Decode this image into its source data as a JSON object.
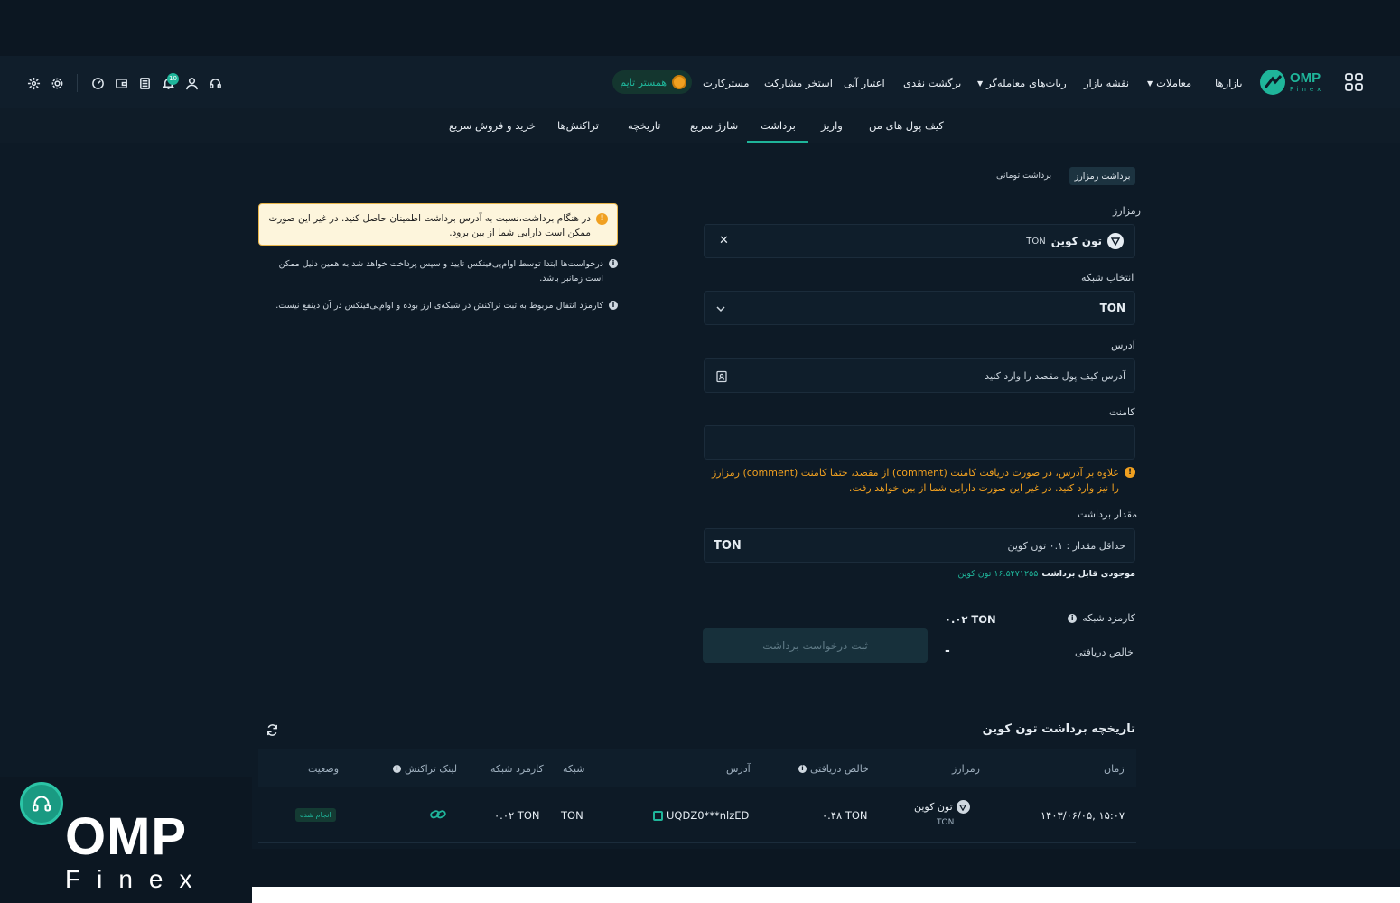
{
  "brand": {
    "name": "OMP",
    "sub": "Finex"
  },
  "nav": {
    "markets": "بازارها",
    "trades": "معاملات",
    "market_map": "نقشه بازار",
    "bots": "ربات‌های معامله‌گر",
    "cashback": "برگشت نقدی",
    "instant_credit": "اعتبار آنی",
    "pool": "استخر مشارکت",
    "subscriptions": "مستر‌کارت",
    "hamster": "همستر تایم",
    "notif_count": "10"
  },
  "subnav": {
    "wallet": "کیف پول های من",
    "deposit": "واریز",
    "withdraw": "برداشت",
    "quick_charge": "شارژ سریع",
    "history": "تاریخچه",
    "transactions": "تراکنش‌ها",
    "quick_trade": "خرید و فروش سریع"
  },
  "form": {
    "tab_crypto": "برداشت رمزارز",
    "tab_toman": "برداشت تومانی",
    "crypto_label": "رمزارز",
    "coin_name": "تون کوین",
    "coin_symbol": "TON",
    "network_label": "انتخاب شبکه",
    "network_value": "TON",
    "address_label": "آدرس",
    "address_placeholder": "آدرس کیف پول مقصد را وارد کنید",
    "comment_label": "کامنت",
    "comment_warning": "علاوه بر آدرس، در صورت دریافت کامنت (comment) از مقصد، حتما کامنت (comment) رمزارز را نیز وارد کنید. در غیر این صورت دارایی شما از بین خواهد رفت.",
    "amount_label": "مقدار برداشت",
    "amount_placeholder": "حداقل مقدار : ۰.۱ تون کوین",
    "amount_unit": "TON",
    "balance_label": "موجودی قابل برداشت",
    "balance_value": "۱۶.۵۴۷۱۲۵۵ تون کوین",
    "fee_label": "کارمزد شبکه",
    "fee_value": "۰.۰۲ TON",
    "net_label": "خالص دریافتی",
    "net_value": "-",
    "submit": "ثبت درخواست برداشت"
  },
  "notices": {
    "warning": "در هنگام برداشت،نسبت به آدرس برداشت اطمینان حاصل کنید. در غیر این صورت ممکن است دارایی شما از بین برود.",
    "info1": "درخواست‌ها ابتدا توسط اوام‌پی‌فینکس تایید و سپس پرداخت خواهد شد به همین دلیل ممکن است زمانبر باشد.",
    "info2": "کارمزد انتقال مربوط به ثبت تراکنش در شبکه‌ی ارز بوده و اوام‌پی‌فینکس در آن ذینفع نیست."
  },
  "history": {
    "title": "تاریخچه برداشت تون کوین",
    "columns": {
      "time": "زمان",
      "crypto": "رمزارز",
      "net": "خالص دریافتی",
      "address": "آدرس",
      "network": "شبکه",
      "fee": "کارمزد شبکه",
      "tx_link": "لینک تراکنش",
      "status": "وضعیت"
    },
    "rows": [
      {
        "time": "۱۴۰۳/۰۶/۰۵, ۱۵:۰۷",
        "coin": "تون کوین",
        "symbol": "TON",
        "net": "۰.۴۸ TON",
        "address": "UQDZ0***nlzED",
        "network": "TON",
        "fee": "۰.۰۲ TON",
        "status": "انجام شده"
      }
    ]
  },
  "colors": {
    "accent": "#1fb59a",
    "warning": "#f0a020",
    "bg": "#0d1a26"
  }
}
